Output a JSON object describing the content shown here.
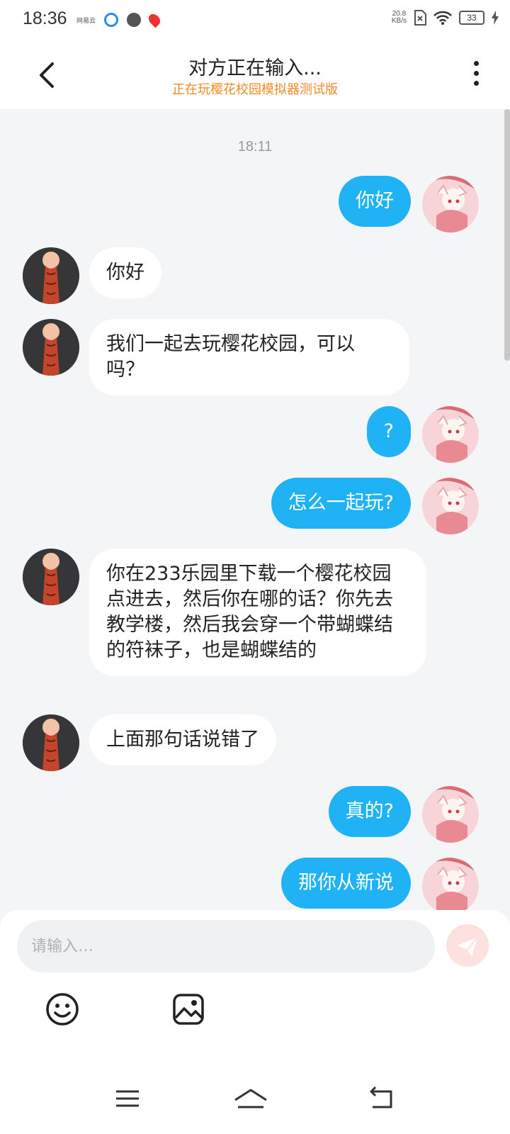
{
  "status_bar": {
    "time": "18:36",
    "app_label": "网易云",
    "net_speed_value": "20.8",
    "net_speed_unit": "KB/s",
    "battery": "33"
  },
  "header": {
    "title": "对方正在输入...",
    "subtitle": "正在玩樱花校园模拟器测试版",
    "subtitle_color": "#f08a24"
  },
  "chat": {
    "timestamp": "18:11",
    "messages": [
      {
        "sender": "me",
        "text": "你好"
      },
      {
        "sender": "other",
        "text": "你好"
      },
      {
        "sender": "other",
        "text": "我们一起去玩樱花校园，可以吗？"
      },
      {
        "sender": "me",
        "text": "?"
      },
      {
        "sender": "me",
        "text": "怎么一起玩?"
      },
      {
        "sender": "other",
        "text": "你在233乐园里下载一个樱花校园点进去，然后你在哪的话？你先去教学楼，然后我会穿一个带蝴蝶结的符袜子，也是蝴蝶结的"
      },
      {
        "sender": "other",
        "text": "上面那句话说错了"
      },
      {
        "sender": "me",
        "text": "真的?"
      },
      {
        "sender": "me",
        "text": "那你从新说"
      }
    ]
  },
  "input": {
    "placeholder": "请输入…",
    "value": ""
  },
  "colors": {
    "my_bubble": "#1fb2f5",
    "other_bubble": "#ffffff",
    "background": "#f4f5f7"
  },
  "icons": {
    "back": "back-arrow-icon",
    "more": "more-vertical-icon",
    "send": "send-icon",
    "emoji": "emoji-icon",
    "image": "image-icon"
  }
}
